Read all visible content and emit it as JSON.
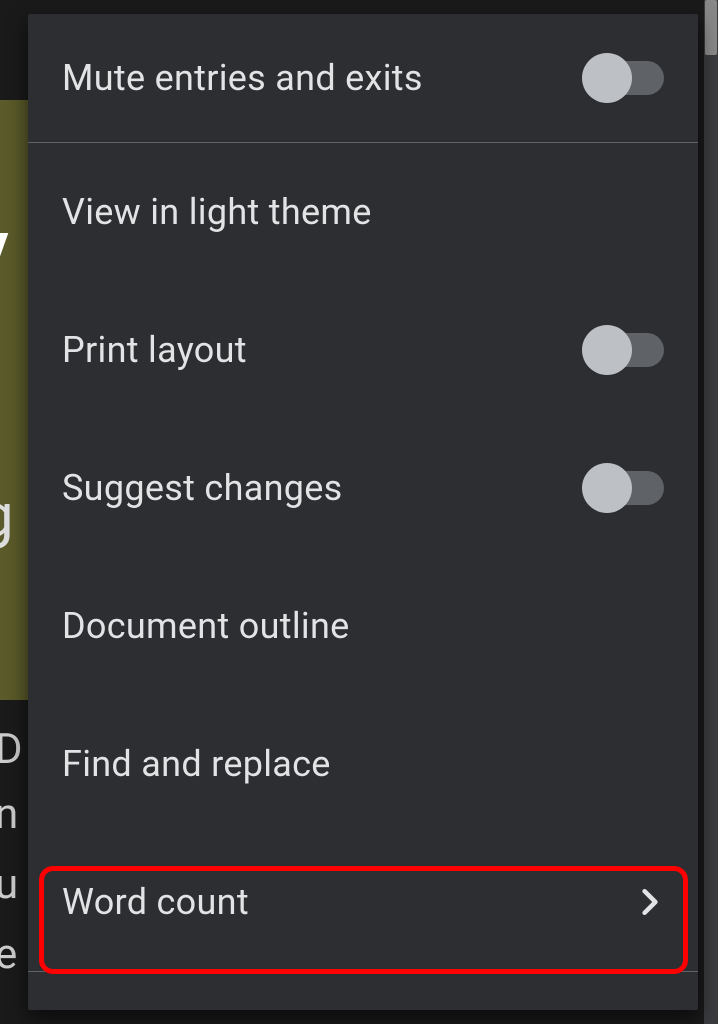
{
  "menu": {
    "items": [
      {
        "label": "Mute entries and exits",
        "type": "toggle",
        "state": "off"
      },
      {
        "label": "View in light theme",
        "type": "action"
      },
      {
        "label": "Print layout",
        "type": "toggle",
        "state": "off"
      },
      {
        "label": "Suggest changes",
        "type": "toggle",
        "state": "off"
      },
      {
        "label": "Document outline",
        "type": "action"
      },
      {
        "label": "Find and replace",
        "type": "action"
      },
      {
        "label": "Word count",
        "type": "submenu"
      }
    ]
  },
  "bg": {
    "t1": "V",
    "t2": "g",
    "t3": "D",
    "t4": "n",
    "t5": "u",
    "t6": "e"
  }
}
